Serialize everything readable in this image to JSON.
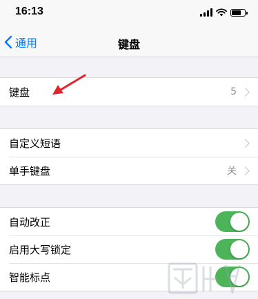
{
  "status_bar": {
    "time": "16:13",
    "icons": [
      "cellular-signal-icon",
      "wifi-icon",
      "battery-icon"
    ]
  },
  "nav": {
    "back_label": "通用",
    "title": "键盘",
    "accent_color": "#007aff"
  },
  "groups": [
    {
      "rows": [
        {
          "label": "键盘",
          "value": "5",
          "accessory": "chevron"
        }
      ]
    },
    {
      "rows": [
        {
          "label": "自定义短语",
          "value": "",
          "accessory": "chevron"
        },
        {
          "label": "单手键盘",
          "value": "关",
          "accessory": "chevron"
        }
      ]
    },
    {
      "rows": [
        {
          "label": "自动改正",
          "accessory": "toggle",
          "on": true
        },
        {
          "label": "启用大写锁定",
          "accessory": "toggle",
          "on": true
        },
        {
          "label": "智能标点",
          "accessory": "toggle",
          "on": true
        }
      ]
    }
  ],
  "toggle_on_color": "#4cb55a",
  "annotation_color": "#e0262b"
}
